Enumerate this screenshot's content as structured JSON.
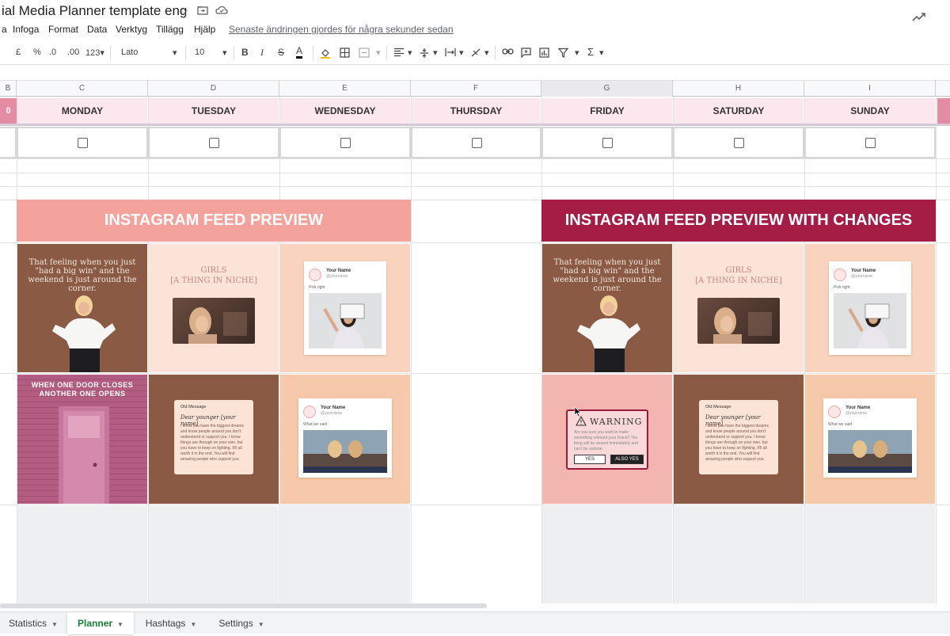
{
  "title_bar": {
    "doc_title": "ial Media Planner template eng",
    "star_icon": "star-icon",
    "move_icon": "folder-move-icon",
    "cloud_icon": "cloud-status-icon",
    "trend_icon": "trend-icon"
  },
  "menu": {
    "items": [
      "a",
      "Infoga",
      "Format",
      "Data",
      "Verktyg",
      "Tillägg",
      "Hjälp"
    ],
    "last_edit": "Senaste ändringen gjordes för några sekunder sedan"
  },
  "toolbar": {
    "currency": "£",
    "percent": "%",
    "decrease_decimals": ".0",
    "increase_decimals": ".00",
    "number_format": "123",
    "font": "Lato",
    "font_size": "10",
    "bold": "B",
    "italic": "I",
    "strike": "S",
    "text_color": "A",
    "sigma": "Σ"
  },
  "columns": [
    "B",
    "C",
    "D",
    "E",
    "F",
    "G",
    "H",
    "I"
  ],
  "days": [
    "MONDAY",
    "TUESDAY",
    "WEDNESDAY",
    "THURSDAY",
    "FRIDAY",
    "SATURDAY",
    "SUNDAY"
  ],
  "left_stub_text": "0",
  "banners": {
    "left": "INSTAGRAM FEED PREVIEW",
    "right": "INSTAGRAM FEED PREVIEW WITH CHANGES"
  },
  "posts": {
    "quote": "That feeling when you just \"had a big win\" and the weekend is just around the corner.",
    "girls_line1": "GIRLS",
    "girls_line2": "[A THING IN NICHE]",
    "card_name": "Your Name",
    "card_handle": "@yourname",
    "card_text": "Pick right",
    "card_text_2": "What we said",
    "door_line1": "WHEN ONE DOOR CLOSES",
    "door_line2": "ANOTHER ONE OPENS",
    "msg_head": "Old Message",
    "msg_title": "Dear younger [your name]",
    "msg_body": "I know you have the biggest dreams and know people around you don't understand or support you. I know things are through on your own. but you have to keep on fighting. It'll all worth it in the end. You will find amazing people who support you.",
    "warn_title": "WARNING",
    "warn_body": "Are you sure you want to make something relevant your brand? The thing will be viewed immediately and can't be undone.",
    "warn_yes": "YES",
    "warn_also_yes": "ALSO YES"
  },
  "sheet_tabs": [
    "Statistics",
    "Planner",
    "Hashtags",
    "Settings"
  ],
  "active_tab": "Planner",
  "colors": {
    "day_header_bg": "#fde7ee",
    "left_banner": "#f4a29c",
    "right_banner": "#a51d45",
    "active_tab_text": "#188038"
  }
}
